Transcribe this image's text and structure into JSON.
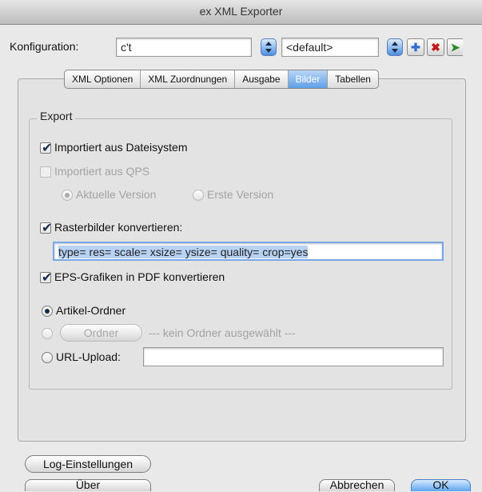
{
  "window": {
    "title": "ex XML Exporter"
  },
  "config": {
    "label": "Konfiguration:",
    "value": "c't",
    "default_value": "<default>"
  },
  "tabs": [
    {
      "label": "XML Optionen",
      "active": false
    },
    {
      "label": "XML Zuordnungen",
      "active": false
    },
    {
      "label": "Ausgabe",
      "active": false
    },
    {
      "label": "Bilder",
      "active": true
    },
    {
      "label": "Tabellen",
      "active": false
    }
  ],
  "export": {
    "legend": "Export",
    "import_fs": {
      "label": "Importiert aus Dateisystem",
      "checked": true
    },
    "import_qps": {
      "label": "Importiert aus QPS",
      "checked": false,
      "disabled": true
    },
    "version_current": {
      "label": "Aktuelle Version",
      "selected": true
    },
    "version_first": {
      "label": "Erste Version",
      "selected": false
    },
    "raster": {
      "label": "Rasterbilder konvertieren:",
      "checked": true
    },
    "raster_params": "type= res= scale= xsize= ysize= quality= crop=yes",
    "eps": {
      "label": "EPS-Grafiken in PDF konvertieren",
      "checked": true
    },
    "article_folder": {
      "label": "Artikel-Ordner",
      "selected": true
    },
    "folder_button": "Ordner",
    "folder_status": "--- kein Ordner ausgewählt ---",
    "url_upload": {
      "label": "URL-Upload:",
      "value": ""
    }
  },
  "buttons": {
    "log": "Log-Einstellungen",
    "about": "Über",
    "cancel": "Abbrechen",
    "ok": "OK"
  },
  "icons": {
    "add": "plus-icon",
    "delete": "delete-x-icon",
    "export": "export-arrow-icon"
  }
}
